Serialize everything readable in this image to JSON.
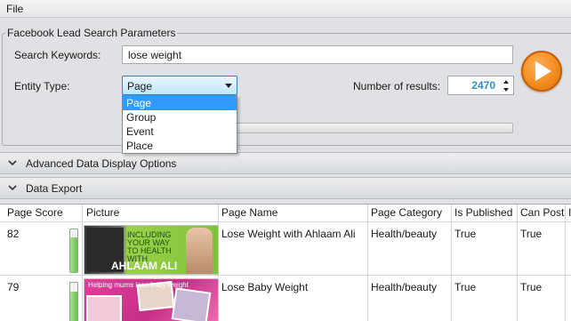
{
  "menu": {
    "file_label": "File"
  },
  "params": {
    "group_title": "Facebook Lead Search Parameters",
    "keywords_label": "Search Keywords:",
    "keywords_value": "lose weight",
    "entity_label": "Entity Type:",
    "entity_selected": "Page",
    "entity_options": [
      "Page",
      "Group",
      "Event",
      "Place"
    ],
    "results_label": "Number of results:",
    "results_value": "2470",
    "go_icon": "play-arrow-icon",
    "go_color": "#f28a1c"
  },
  "expanders": {
    "advanced_label": "Advanced Data Display Options",
    "export_label": "Data Export"
  },
  "grid": {
    "columns": [
      "Page Score",
      "Picture",
      "Page Name",
      "Page Category",
      "Is Published",
      "Can Post",
      "I"
    ],
    "rows": [
      {
        "score": "82",
        "score_level": 0.82,
        "thumb_top_text": "INCLUDING YOUR WAY TO HEALTH WITH",
        "thumb_name": "AHLAAM ALI",
        "name": "Lose Weight with Ahlaam Ali",
        "category": "Health/beauty",
        "published": "True",
        "can_post": "True"
      },
      {
        "score": "79",
        "score_level": 0.79,
        "thumb_top_text": "Helping mums lose baby weight",
        "thumb_name": "",
        "name": "Lose Baby Weight",
        "category": "Health/beauty",
        "published": "True",
        "can_post": "True"
      }
    ]
  },
  "colors": {
    "accent": "#3399ff",
    "results_text": "#2b8fd6",
    "bar_green": "#69c24e"
  }
}
